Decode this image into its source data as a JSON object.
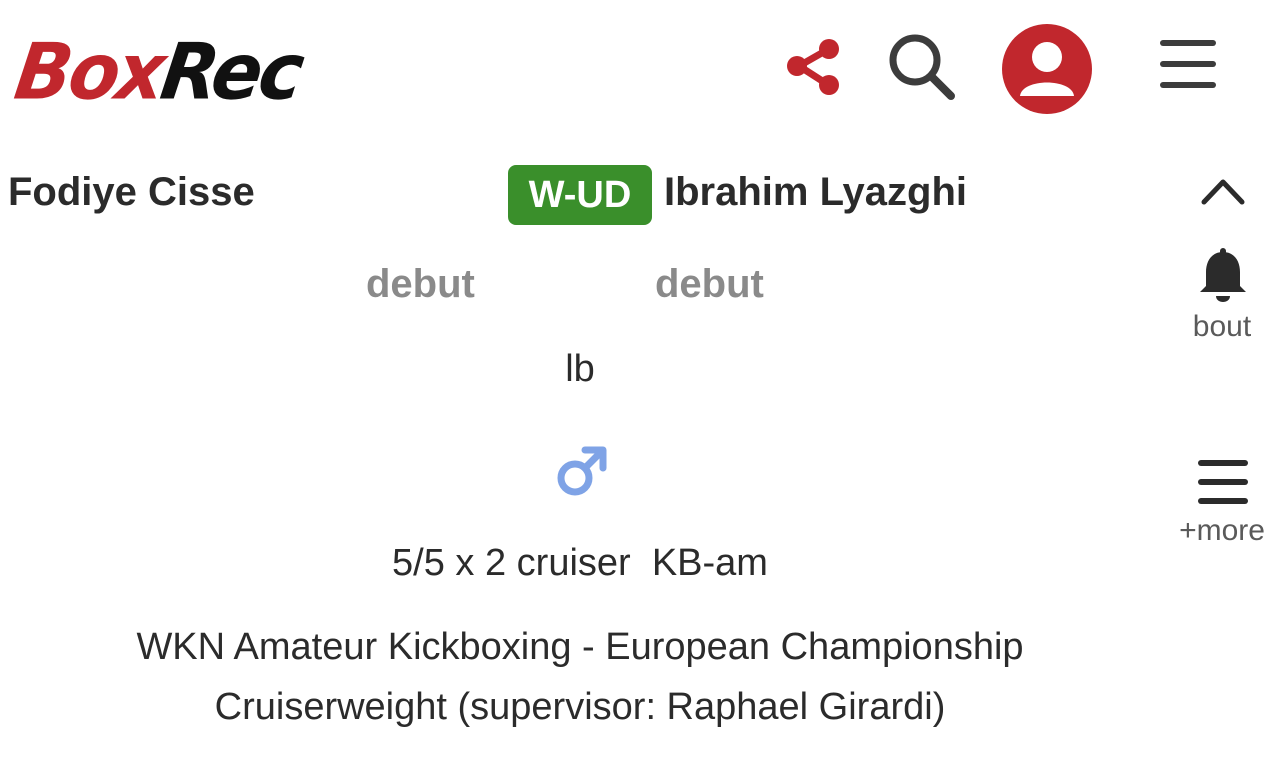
{
  "header": {
    "logo_part1": "Box",
    "logo_part2": "Rec",
    "icons": [
      "share-icon",
      "search-icon",
      "user-avatar-icon",
      "menu-icon"
    ]
  },
  "fight": {
    "fighter_left": "Fodiye Cisse",
    "result": "W-UD",
    "fighter_right": "Ibrahim Lyazghi",
    "record_left": "debut",
    "record_right": "debut",
    "weight_unit": "lb",
    "gender_icon": "male-symbol-icon",
    "bout_info": "5/5 x 2 cruiser  KB-am",
    "title_line1": "WKN Amateur Kickboxing - European Championship",
    "title_line2": "Cruiserweight (supervisor: Raphael Girardi)"
  },
  "rail": {
    "collapse_icon": "chevron-up-icon",
    "bout_icon": "bell-icon",
    "bout_label": "bout",
    "more_icon": "menu-icon",
    "more_label": "+more"
  },
  "colors": {
    "brand_red": "#c1272d",
    "win_green": "#3a8f2b",
    "gender_blue": "#7fa3e6",
    "muted_gray": "#8a8a8a"
  }
}
